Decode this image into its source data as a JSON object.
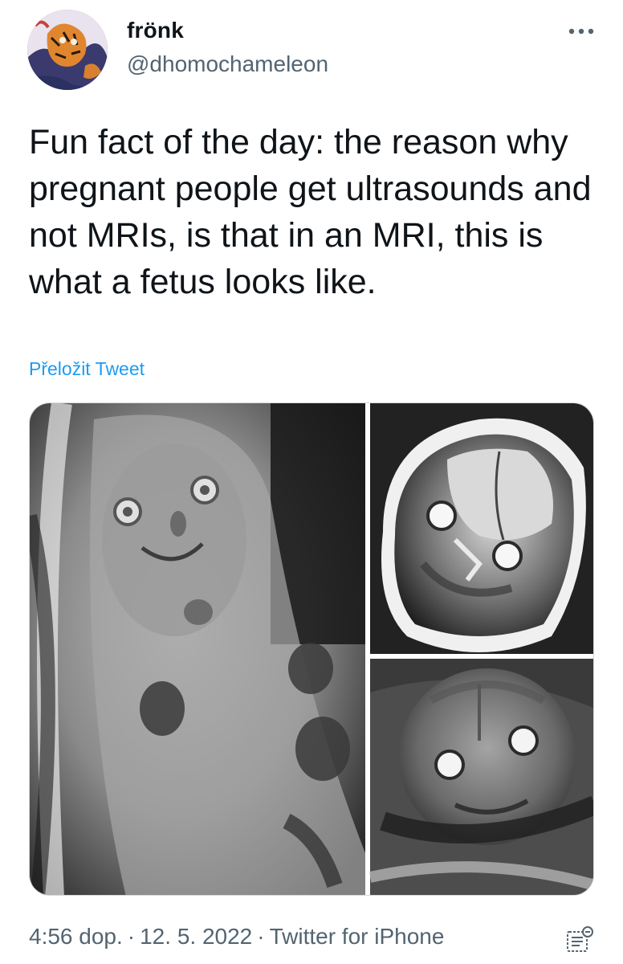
{
  "user": {
    "name": "frönk",
    "handle": "@dhomochameleon"
  },
  "tweet": {
    "text": "Fun fact of the day: the reason why pregnant people get ultrasounds and not MRIs, is that in an MRI, this is what a fetus looks like.",
    "translate_label": "Přeložit Tweet"
  },
  "meta": {
    "time": "4:56 dop.",
    "date": "12. 5. 2022",
    "source": "Twitter for iPhone",
    "separator": "·"
  },
  "icons": {
    "more": "more-horizontal-icon",
    "analytics": "view-analytics-icon"
  },
  "colors": {
    "link": "#1d9bf0",
    "secondary_text": "#536471",
    "primary_text": "#0f1419"
  }
}
